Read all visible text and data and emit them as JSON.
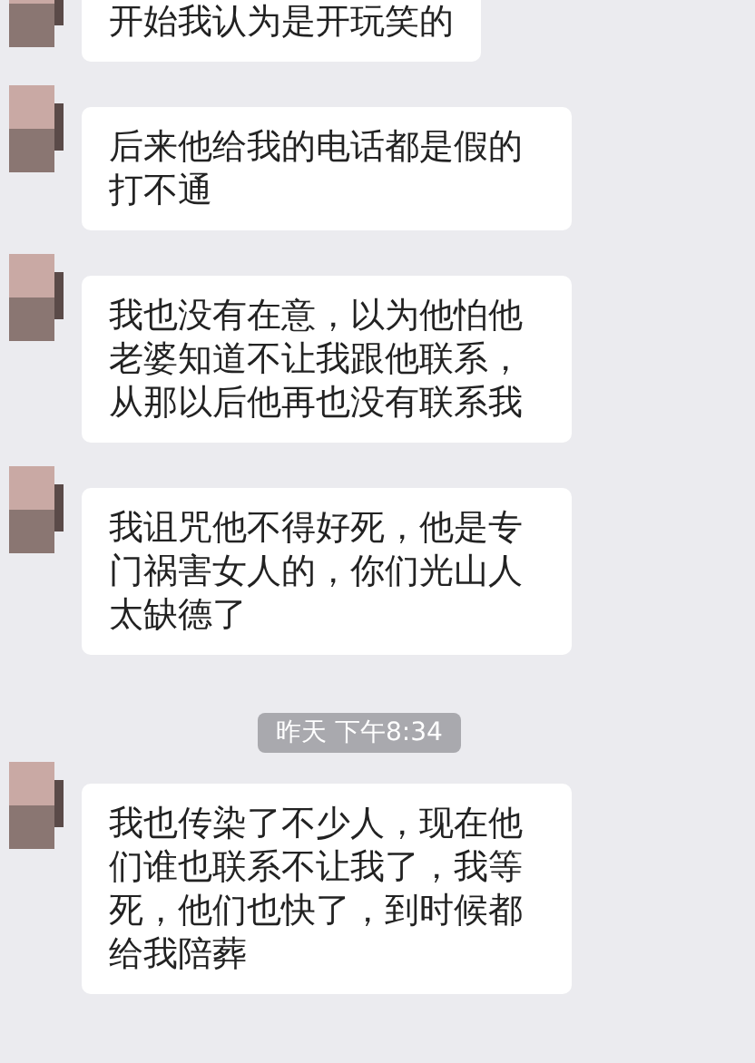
{
  "messages": [
    {
      "kind": "text",
      "text": "开始我认为是开玩笑的"
    },
    {
      "kind": "text",
      "text": "后来他给我的电话都是假的打不通"
    },
    {
      "kind": "text",
      "text": "我也没有在意，以为他怕他老婆知道不让我跟他联系，从那以后他再也没有联系我"
    },
    {
      "kind": "text",
      "text": "我诅咒他不得好死，他是专门祸害女人的，你们光山人太缺德了"
    },
    {
      "kind": "time",
      "text": "昨天 下午8:34"
    },
    {
      "kind": "text",
      "text": "我也传染了不少人，现在他们谁也联系不让我了，我等死，他们也快了，到时候都给我陪葬"
    }
  ]
}
